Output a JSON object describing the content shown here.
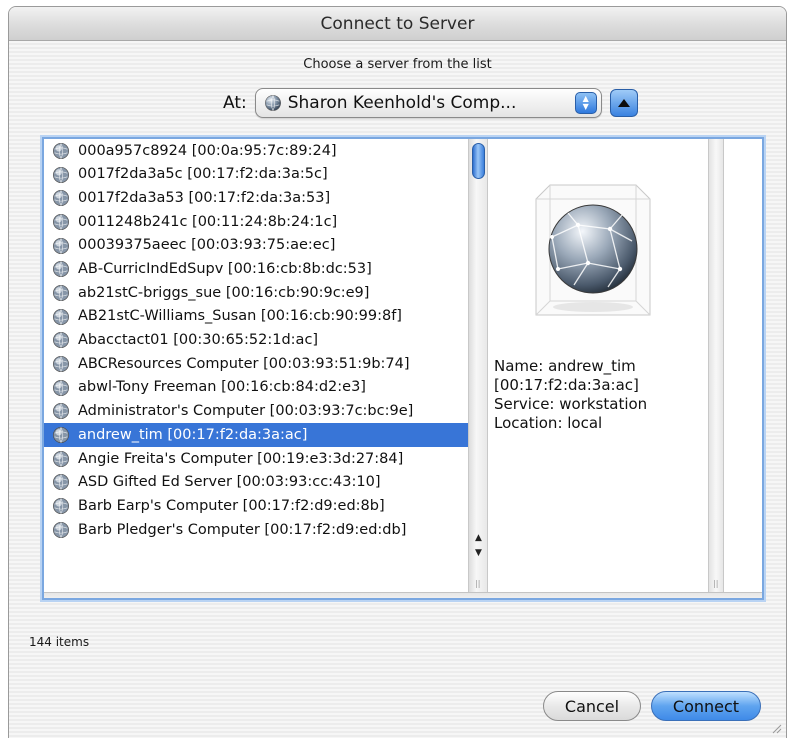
{
  "window": {
    "title": "Connect to Server"
  },
  "prompt": "Choose a server from the list",
  "location": {
    "label": "At:",
    "selected": "Sharon Keenhold's Comp...",
    "popup_icon": "globe-icon",
    "up_icon": "triangle-up-icon"
  },
  "servers": [
    {
      "label": "000a957c8924 [00:0a:95:7c:89:24]",
      "selected": false
    },
    {
      "label": "0017f2da3a5c [00:17:f2:da:3a:5c]",
      "selected": false
    },
    {
      "label": "0017f2da3a53 [00:17:f2:da:3a:53]",
      "selected": false
    },
    {
      "label": "0011248b241c [00:11:24:8b:24:1c]",
      "selected": false
    },
    {
      "label": "00039375aeec [00:03:93:75:ae:ec]",
      "selected": false
    },
    {
      "label": "AB-CurricIndEdSupv [00:16:cb:8b:dc:53]",
      "selected": false
    },
    {
      "label": "ab21stC-briggs_sue  [00:16:cb:90:9c:e9]",
      "selected": false
    },
    {
      "label": "AB21stC-Williams_Susan [00:16:cb:90:99:8f]",
      "selected": false
    },
    {
      "label": "Abacctact01 [00:30:65:52:1d:ac]",
      "selected": false
    },
    {
      "label": "ABCResources Computer [00:03:93:51:9b:74]",
      "selected": false
    },
    {
      "label": "abwl-Tony Freeman [00:16:cb:84:d2:e3]",
      "selected": false
    },
    {
      "label": "Administrator's Computer [00:03:93:7c:bc:9e]",
      "selected": false
    },
    {
      "label": "andrew_tim [00:17:f2:da:3a:ac]",
      "selected": true
    },
    {
      "label": "Angie Freita's Computer [00:19:e3:3d:27:84]",
      "selected": false
    },
    {
      "label": "ASD Gifted Ed Server [00:03:93:cc:43:10]",
      "selected": false
    },
    {
      "label": "Barb Earp's Computer [00:17:f2:d9:ed:8b]",
      "selected": false
    },
    {
      "label": "Barb Pledger's Computer [00:17:f2:d9:ed:db]",
      "selected": false
    }
  ],
  "preview": {
    "icon": "network-globe-icon",
    "lines": [
      "Name: andrew_tim",
      "[00:17:f2:da:3a:ac]",
      "Service: workstation",
      "Location: local"
    ]
  },
  "item_count": "144 items",
  "buttons": {
    "cancel": "Cancel",
    "connect": "Connect"
  },
  "colors": {
    "selection": "#3875d7",
    "accent_button": "#5fa4ef"
  }
}
